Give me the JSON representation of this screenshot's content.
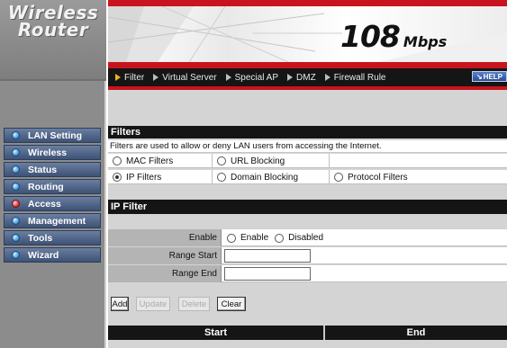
{
  "brand": {
    "line1": "Wireless",
    "line2": "Router"
  },
  "header": {
    "speed": "108",
    "speed_unit": "Mbps",
    "help_label": "HELP"
  },
  "menu": [
    {
      "label": "Filter",
      "active": true
    },
    {
      "label": "Virtual Server"
    },
    {
      "label": "Special AP"
    },
    {
      "label": "DMZ"
    },
    {
      "label": "Firewall Rule"
    }
  ],
  "sidebar": {
    "items": [
      {
        "label": "LAN Setting"
      },
      {
        "label": "Wireless"
      },
      {
        "label": "Status"
      },
      {
        "label": "Routing"
      },
      {
        "label": "Access",
        "active": true
      },
      {
        "label": "Management"
      },
      {
        "label": "Tools"
      },
      {
        "label": "Wizard"
      }
    ]
  },
  "filters": {
    "title": "Filters",
    "description": "Filters are used to allow or deny LAN users from accessing the Internet.",
    "options": [
      [
        "MAC Filters",
        "URL Blocking",
        ""
      ],
      [
        "IP Filters",
        "Domain Blocking",
        "Protocol Filters"
      ]
    ],
    "selected": "IP Filters"
  },
  "ip_filter": {
    "title": "IP Filter",
    "enable_label": "Enable",
    "enable_option": "Enable",
    "disabled_option": "Disabled",
    "range_start_label": "Range Start",
    "range_start_value": "",
    "range_end_label": "Range End",
    "range_end_value": ""
  },
  "buttons": {
    "add": "Add",
    "update": "Update",
    "delete": "Delete",
    "clear": "Clear"
  },
  "table": {
    "columns": [
      "Start",
      "End"
    ]
  },
  "colors": {
    "accent_red": "#c8141e",
    "dark_bar": "#151515",
    "nav_blue": "#3d5276"
  }
}
